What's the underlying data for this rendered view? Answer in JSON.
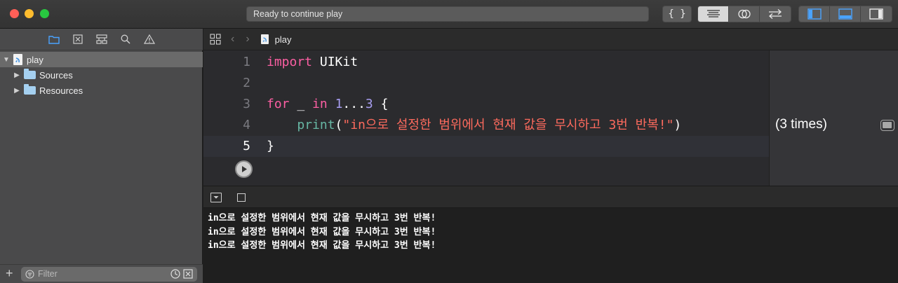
{
  "window": {
    "status_text": "Ready to continue play",
    "toolbar_buttons": [
      "{}",
      "standard-editor-icon",
      "assistant-editor-icon",
      "version-editor-icon",
      "toggle-navigator-icon",
      "toggle-debug-icon",
      "toggle-inspector-icon"
    ]
  },
  "navigator": {
    "tree": [
      {
        "label": "play",
        "icon": "playground-file-icon",
        "expanded": true
      },
      {
        "label": "Sources",
        "icon": "folder-icon",
        "expanded": false
      },
      {
        "label": "Resources",
        "icon": "folder-icon",
        "expanded": false
      }
    ],
    "filter_placeholder": "Filter"
  },
  "jumpbar": {
    "file_name": "play"
  },
  "editor": {
    "line_numbers": [
      "1",
      "2",
      "3",
      "4",
      "5"
    ],
    "current_line": "5",
    "lines": {
      "l1_kw": "import",
      "l1_rest": " UIKit",
      "l3_kw_for": "for",
      "l3_mid": " _ ",
      "l3_kw_in": "in",
      "l3_sp": " ",
      "l3_num1": "1",
      "l3_op": "...",
      "l3_num2": "3",
      "l3_brace": " {",
      "l4_indent": "    ",
      "l4_fn": "print",
      "l4_open": "(",
      "l4_str": "\"in으로 설정한 범위에서 현재 값을 무시하고 3번 반복!\"",
      "l4_close": ")",
      "l5_brace": "}"
    }
  },
  "results": {
    "line4": "(3 times)"
  },
  "console": {
    "output": [
      "in으로 설정한 범위에서 현재 값을 무시하고 3번 반복!",
      "in으로 설정한 범위에서 현재 값을 무시하고 3번 반복!",
      "in으로 설정한 범위에서 현재 값을 무시하고 3번 반복!"
    ]
  },
  "colors": {
    "keyword": "#fc5fa3",
    "number": "#a79df0",
    "string": "#fc6a5d",
    "function": "#67b7a4"
  }
}
